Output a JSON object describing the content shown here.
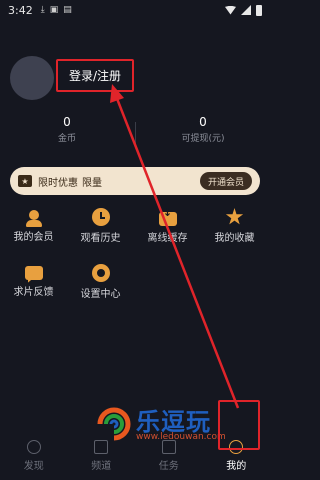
{
  "status_bar": {
    "time": "3:42"
  },
  "profile": {
    "login_label": "登录/注册"
  },
  "stats": [
    {
      "value": "0",
      "label": "金币"
    },
    {
      "value": "0",
      "label": "可提现(元)"
    }
  ],
  "vip_banner": {
    "promo_text": "限时优惠",
    "limit_text": "限量",
    "button_label": "开通会员"
  },
  "menu_items": [
    {
      "label": "我的会员",
      "icon": "user-icon"
    },
    {
      "label": "观看历史",
      "icon": "clock-icon"
    },
    {
      "label": "离线缓存",
      "icon": "download-icon"
    },
    {
      "label": "我的收藏",
      "icon": "star-icon"
    },
    {
      "label": "求片反馈",
      "icon": "chat-icon"
    },
    {
      "label": "设置中心",
      "icon": "gear-icon"
    }
  ],
  "tabbar": [
    {
      "label": "发现",
      "icon": "compass-icon",
      "active": false
    },
    {
      "label": "频道",
      "icon": "channel-icon",
      "active": false
    },
    {
      "label": "任务",
      "icon": "task-icon",
      "active": false
    },
    {
      "label": "我的",
      "icon": "user-icon",
      "active": true
    }
  ],
  "watermark": {
    "title": "乐逗玩",
    "url": "www.ledouwan.com"
  },
  "colors": {
    "background": "#151720",
    "accent": "#e8a03f",
    "highlight": "#e0242a",
    "vip_bg": "#f2e4cf"
  }
}
